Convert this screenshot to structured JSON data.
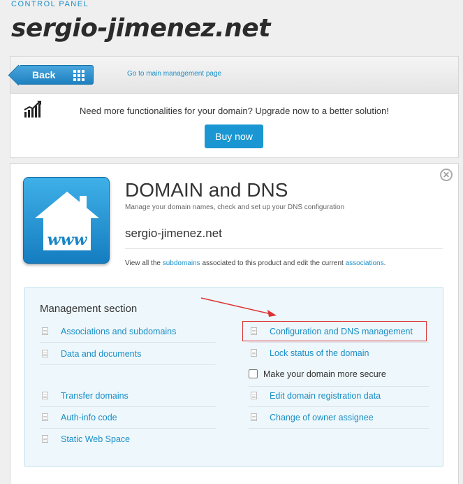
{
  "header": {
    "control_panel_label": "CONTROL PANEL",
    "site_title": "sergio-jimenez.net"
  },
  "nav": {
    "back_label": "Back",
    "main_link": "Go to main management page"
  },
  "upgrade": {
    "text": "Need more functionalities for your domain? Upgrade now to a better solution!",
    "buy_label": "Buy now"
  },
  "domain_panel": {
    "title": "DOMAIN and DNS",
    "subtitle": "Manage your domain names, check and set up your DNS configuration",
    "domain_name": "sergio-jimenez.net",
    "info_prefix": "View all the ",
    "info_link1": "subdomains",
    "info_middle": " associated to this product and edit the current ",
    "info_link2": "associations",
    "info_suffix": ".",
    "close_glyph": "✕"
  },
  "management": {
    "title": "Management section",
    "left_items": [
      "Associations and subdomains",
      "Data and documents",
      "Transfer domains",
      "Auth-info code",
      "Static Web Space"
    ],
    "right_items": [
      "Configuration and DNS management",
      "Lock status of the domain",
      "Edit domain registration data",
      "Change of owner assignee"
    ],
    "checkbox_label": "Make your domain more secure"
  }
}
